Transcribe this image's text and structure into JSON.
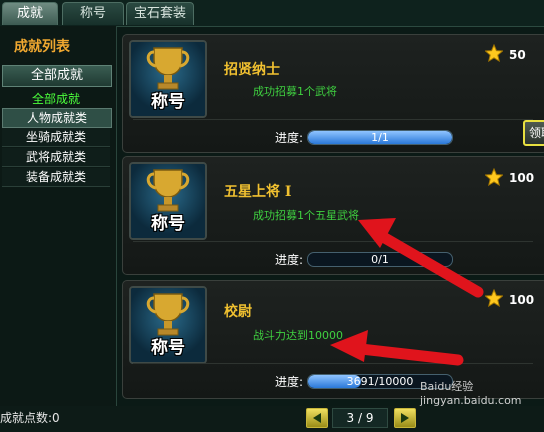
{
  "tabs": [
    {
      "label": "成就"
    },
    {
      "label": "称号"
    },
    {
      "label": "宝石套装"
    }
  ],
  "sidebar": {
    "title": "成就列表",
    "header": "全部成就",
    "items": [
      {
        "label": "全部成就"
      },
      {
        "label": "人物成就类"
      },
      {
        "label": "坐骑成就类"
      },
      {
        "label": "武将成就类"
      },
      {
        "label": "装备成就类"
      }
    ]
  },
  "achievements": [
    {
      "icon_label": "称号",
      "title": "招贤纳士",
      "desc": "成功招募1个武将",
      "points": "50",
      "progress_label": "进度:",
      "progress_text": "1/1",
      "progress_fraction": 1.0,
      "claim_label": "领取"
    },
    {
      "icon_label": "称号",
      "title": "五星上将 I",
      "desc": "成功招募1个五星武将",
      "points": "100",
      "progress_label": "进度:",
      "progress_text": "0/1",
      "progress_fraction": 0.0
    },
    {
      "icon_label": "称号",
      "title": "校尉",
      "desc": "战斗力达到10000",
      "points": "100",
      "progress_label": "进度:",
      "progress_text": "3691/10000",
      "progress_fraction": 0.3691
    }
  ],
  "footer": {
    "points_label": "成就点数:0",
    "pager": "3 / 9"
  },
  "watermark": "Baidu经验 jingyan.baidu.com",
  "colors": {
    "accent": "#f0c030",
    "desc_green": "#3fd040",
    "selected_green": "#4cff3c",
    "arrow_red": "#e0141c"
  },
  "icons": {
    "trophy": "trophy-icon",
    "star": "star-icon",
    "prev": "arrow-left-icon",
    "next": "arrow-right-icon"
  }
}
